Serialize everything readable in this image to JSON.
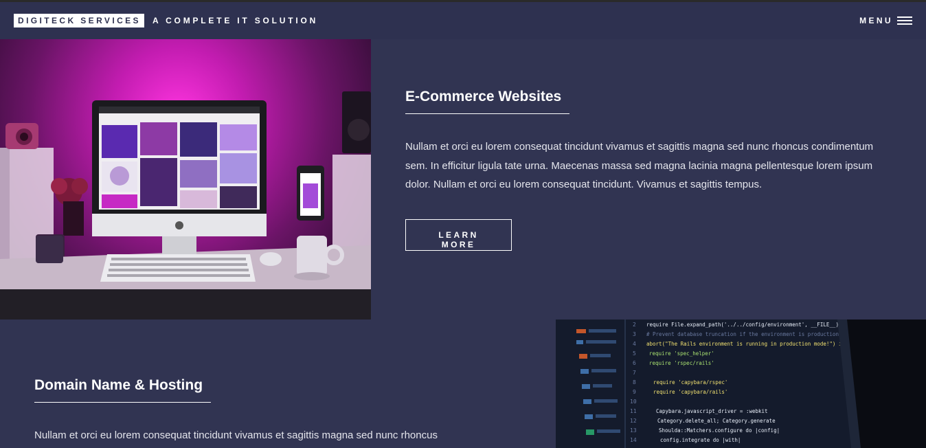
{
  "header": {
    "logo": "DIGITECK SERVICES",
    "tagline": "A COMPLETE IT SOLUTION",
    "menu_label": "MENU"
  },
  "sections": [
    {
      "title": "E-Commerce Websites",
      "text": "Nullam et orci eu lorem consequat tincidunt vivamus et sagittis magna sed nunc rhoncus condimentum sem. In efficitur ligula tate urna. Maecenas massa sed magna lacinia magna pellentesque lorem ipsum dolor. Nullam et orci eu lorem consequat tincidunt. Vivamus et sagittis tempus.",
      "button": "LEARN MORE"
    },
    {
      "title": "Domain Name & Hosting",
      "text": "Nullam et orci eu lorem consequat tincidunt vivamus et sagittis magna sed nunc rhoncus"
    }
  ],
  "code_lines": [
    "require File.expand_path('../../config/environment', __FILE__)",
    "# Prevent database truncation if the environment is production",
    "abort(\"The Rails environment is running in production mode!\") if Rails.env.production?",
    "require 'spec_helper'",
    "require 'rspec/rails'",
    "",
    "require 'capybara/rspec'",
    "require 'capybara/rails'",
    "",
    "Capybara.javascript_driver = :webkit",
    "Category.delete_all; Category.generate",
    "Shoulda::Matchers.configure do |config|",
    "  config.integrate do |with|"
  ],
  "colors": {
    "background": "#313452",
    "header": "#2e3150",
    "accent_magenta": "#ff34e0"
  }
}
